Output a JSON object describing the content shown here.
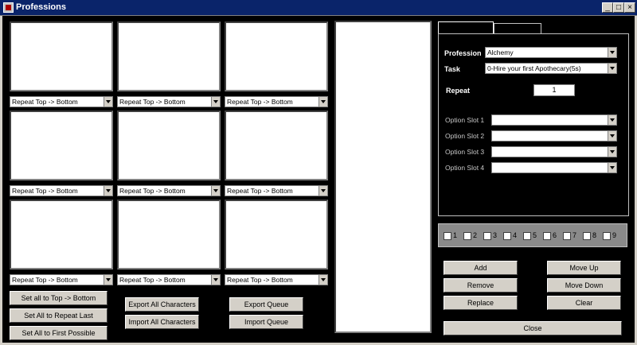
{
  "window": {
    "title": "Professions",
    "minimize": "_",
    "maximize": "□",
    "close": "×"
  },
  "slot_mode_value": "Repeat Top -> Bottom",
  "left_buttons": {
    "set_all_top_bottom": "Set all to Top -> Bottom",
    "set_all_repeat_last": "Set All to Repeat Last",
    "set_all_first_possible": "Set All to First Possible",
    "export_all_characters": "Export All Characters",
    "import_all_characters": "Import All Characters",
    "export_queue": "Export Queue",
    "import_queue": "Import Queue"
  },
  "task_panel": {
    "profession_label": "Profession",
    "profession_value": "Alchemy",
    "task_label": "Task",
    "task_value": "0-Hire your first Apothecary(5s)",
    "repeat_label": "Repeat",
    "repeat_value": "1",
    "option_slots": [
      "Option Slot 1",
      "Option Slot 2",
      "Option Slot 3",
      "Option Slot 4"
    ]
  },
  "day_checkboxes": [
    "1",
    "2",
    "3",
    "4",
    "5",
    "6",
    "7",
    "8",
    "9"
  ],
  "queue_buttons": {
    "add": "Add",
    "remove": "Remove",
    "replace": "Replace",
    "move_up": "Move Up",
    "move_down": "Move Down",
    "clear": "Clear",
    "close": "Close"
  }
}
